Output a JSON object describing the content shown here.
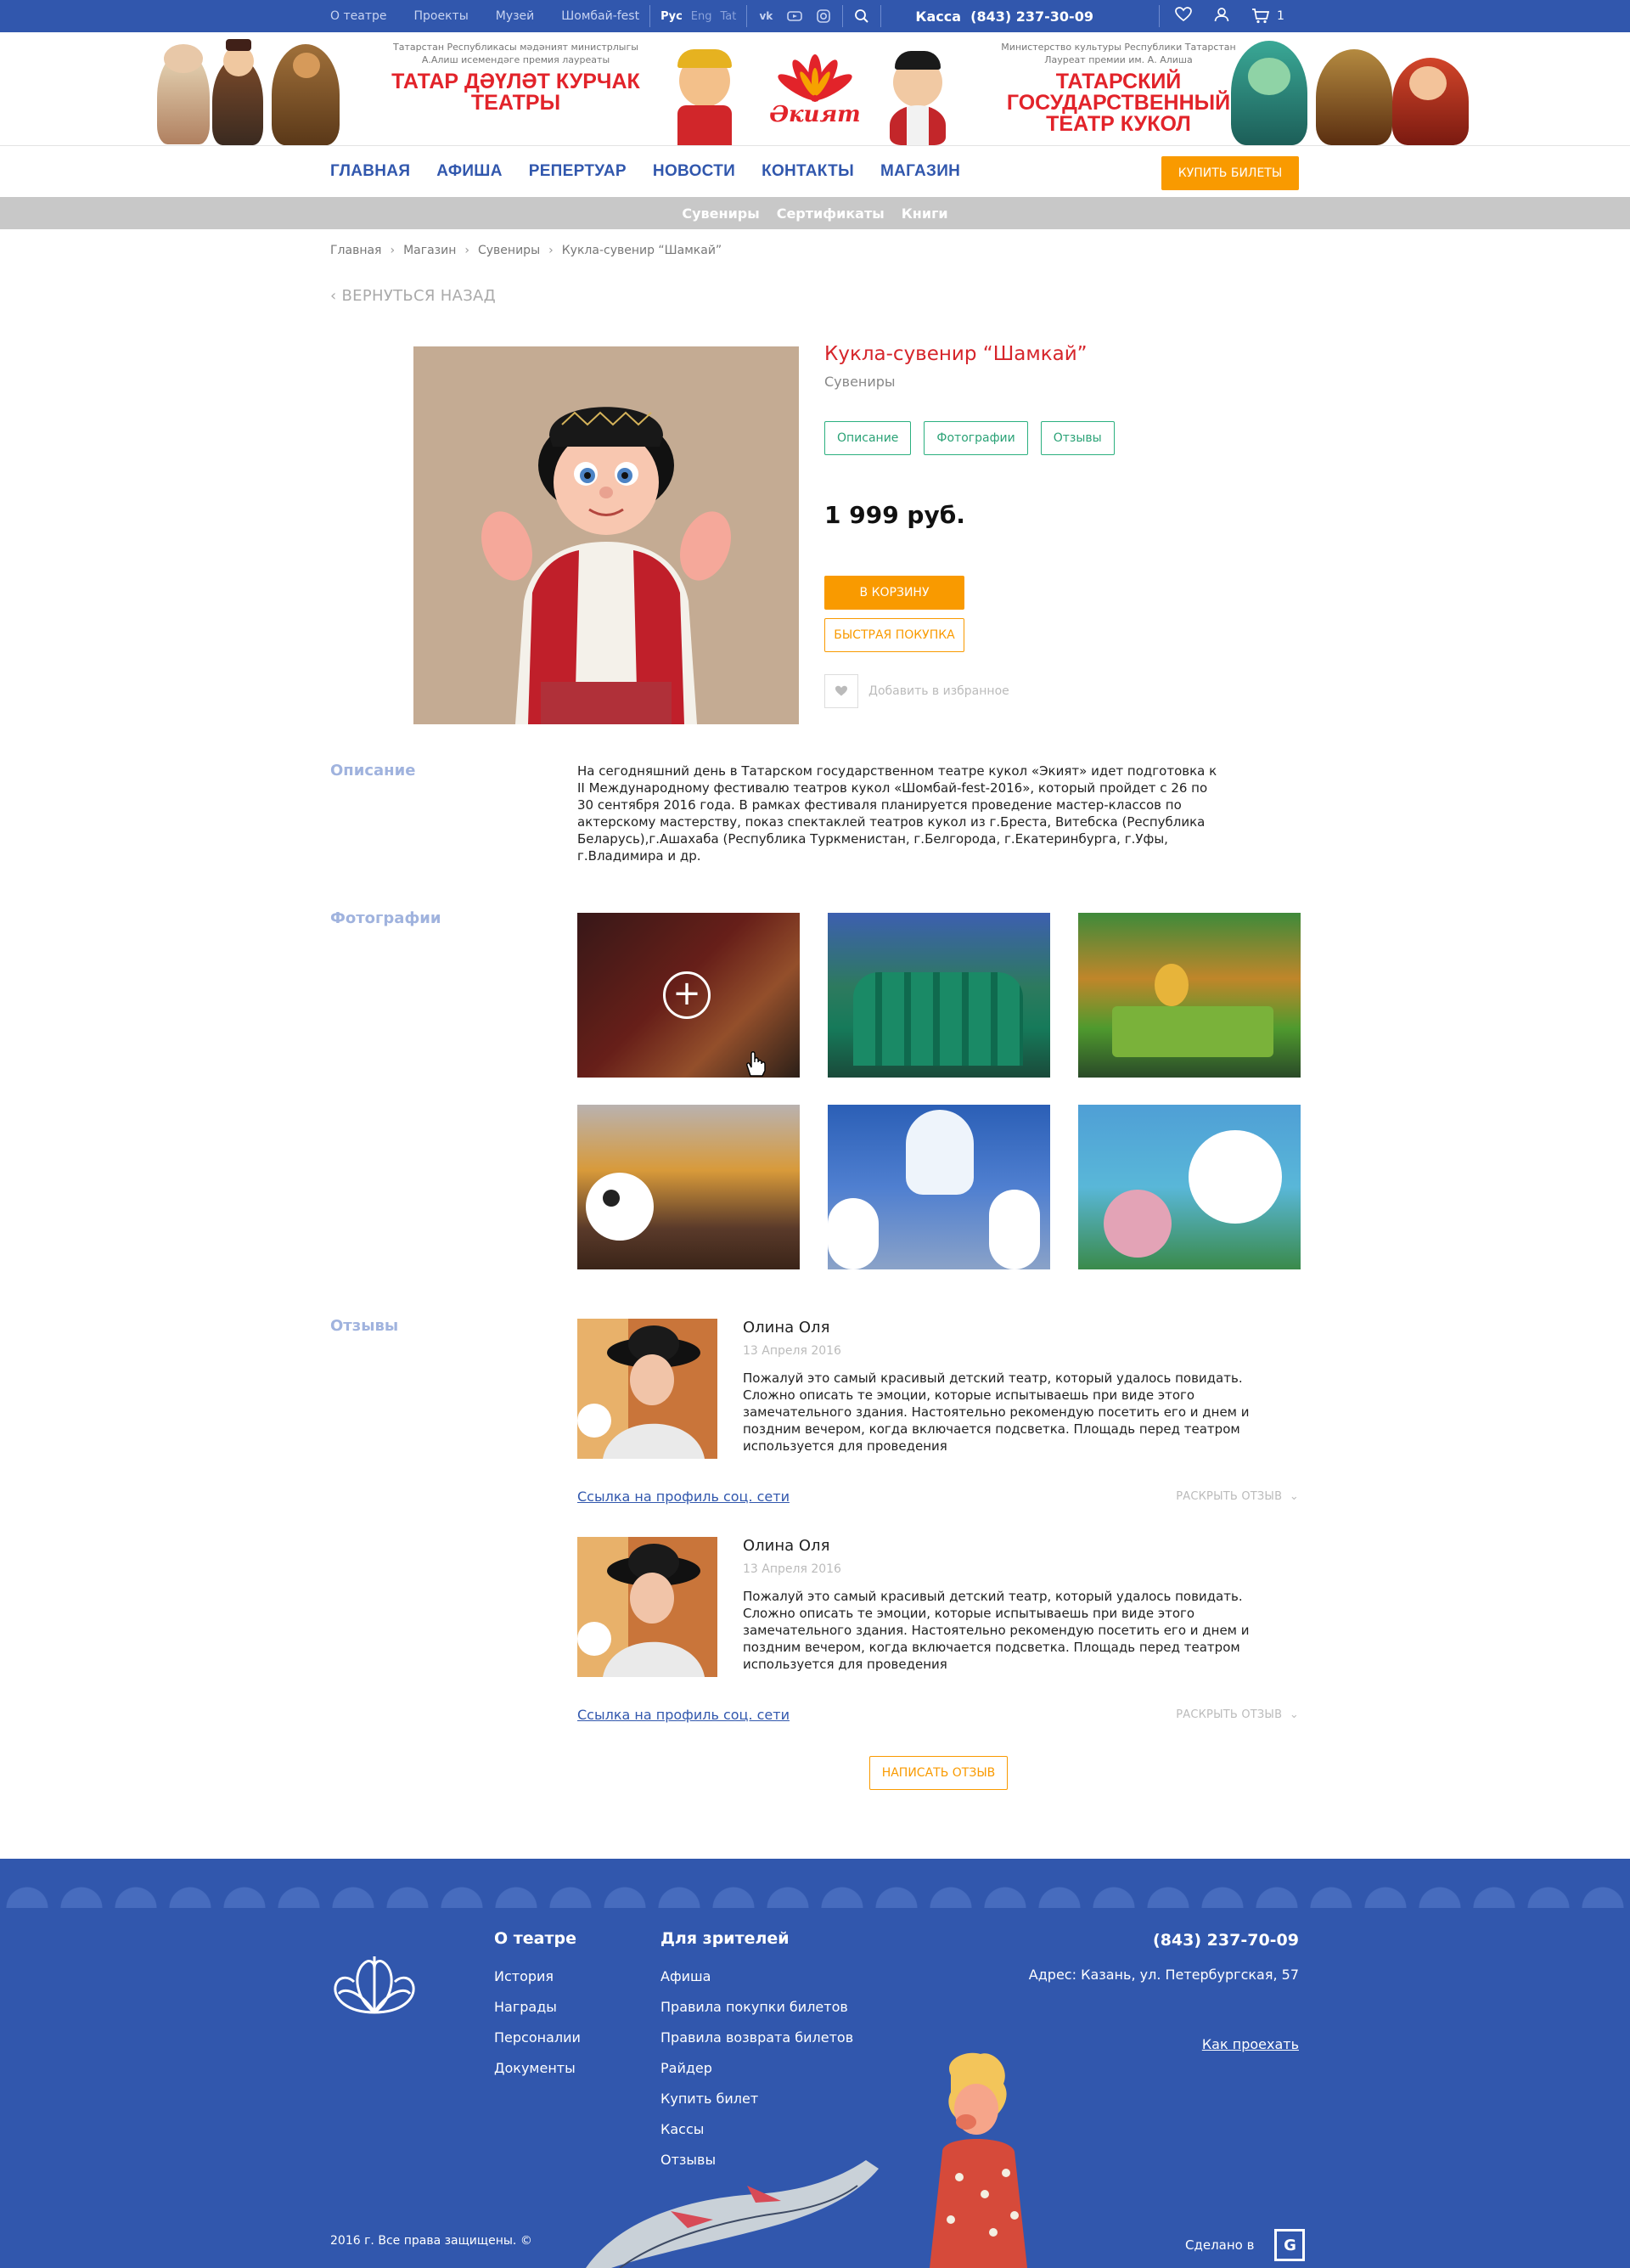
{
  "topbar": {
    "links": [
      "О театре",
      "Проекты",
      "Музей",
      "Шомбай-fest"
    ],
    "lang": {
      "active": "Рус",
      "others": [
        "Eng",
        "Tat"
      ]
    },
    "social": [
      "vk-icon",
      "youtube-icon",
      "instagram-icon"
    ],
    "kassa_label": "Касса",
    "kassa_phone": "(843) 237-30-09",
    "cart_count": "1"
  },
  "banner": {
    "left_sub": "Татарстан Республикасы мәдәният министрлыгы А.Алиш исемендәге премия лауреаты",
    "left_title": "ТАТАР ДӘҮЛӘТ КУРЧАК ТЕАТРЫ",
    "logo_text": "Әкият",
    "right_sub": "Министерство культуры Республики Татарстан Лауреат премии им. А. Алиша",
    "right_title": "ТАТАРСКИЙ ГОСУДАРСТВЕННЫЙ ТЕАТР КУКОЛ"
  },
  "nav": {
    "items": [
      "ГЛАВНАЯ",
      "АФИША",
      "РЕПЕРТУАР",
      "НОВОСТИ",
      "КОНТАКТЫ",
      "МАГАЗИН"
    ],
    "buy_label": "КУПИТЬ БИЛЕТЫ"
  },
  "subnav": [
    "Сувениры",
    "Сертификаты",
    "Книги"
  ],
  "breadcrumbs": [
    "Главная",
    "Магазин",
    "Сувениры",
    "Кукла-сувенир “Шамкай”"
  ],
  "back_label": "ВЕРНУТЬСЯ НАЗАД",
  "product": {
    "title": "Кукла-сувенир “Шамкай”",
    "category": "Сувениры",
    "tabs": [
      "Описание",
      "Фотографии",
      "Отзывы"
    ],
    "price": "1 999 руб.",
    "cart_label": "В КОРЗИНУ",
    "quick_label": "БЫСТРАЯ ПОКУПКА",
    "fav_label": "Добавить в избранное"
  },
  "sections": {
    "description": "Описание",
    "photos": "Фотографии",
    "reviews": "Отзывы"
  },
  "description_text": "На сегодняшний день в Татарском государственном театре кукол «Экият» идет подготовка к II Международному фестивалю театров кукол «Шомбай-fest-2016», который пройдет с 26 по 30 сентября 2016 года. В рамках фестиваля планируется проведение мастер-классов по актерскому мастерству, показ спектаклей театров кукол из г.Бреста, Витебска (Республика Беларусь),г.Ашахаба (Республика Туркменистан,  г.Белгорода, г.Екатеринбурга,  г.Уфы, г.Владимира и др.",
  "reviews": [
    {
      "name": "Олина Оля",
      "date": "13 Апреля 2016",
      "text": "Пожалуй это самый красивый детский театр, который удалось повидать. Сложно описать те эмоции, которые испытываешь при виде этого замечательного здания. Настоятельно рекомендую посетить его и днем и поздним вечером, когда включается подсветка. Площадь перед театром используется для проведения",
      "link": "Ссылка на профиль соц. сети",
      "more": "РАСКРЫТЬ ОТЗЫВ"
    },
    {
      "name": "Олина Оля",
      "date": "13 Апреля 2016",
      "text": "Пожалуй это самый красивый детский театр, который удалось повидать. Сложно описать те эмоции, которые испытываешь при виде этого замечательного здания. Настоятельно рекомендую посетить его и днем и поздним вечером, когда включается подсветка. Площадь перед театром используется для проведения",
      "link": "Ссылка на профиль соц. сети",
      "more": "РАСКРЫТЬ ОТЗЫВ"
    }
  ],
  "write_review": "НАПИСАТЬ ОТЗЫВ",
  "footer": {
    "col1": {
      "title": "О театре",
      "items": [
        "История",
        "Награды",
        "Персоналии",
        "Документы"
      ]
    },
    "col2": {
      "title": "Для зрителей",
      "items": [
        "Афиша",
        "Правила покупки билетов",
        "Правила возврата билетов",
        "Райдер",
        "Купить билет",
        "Кассы",
        "Отзывы"
      ]
    },
    "phone": "(843) 237-70-09",
    "address": "Адрес: Казань, ул. Петербургская, 57",
    "how_to": "Как проехать",
    "copyright": "2016 г. Все права защищены. ©",
    "made_in": "Сделано в"
  },
  "colors": {
    "brand_blue": "#3157ad",
    "accent_orange": "#f99a00",
    "title_red": "#d6252b",
    "tab_green": "#2aa276"
  }
}
